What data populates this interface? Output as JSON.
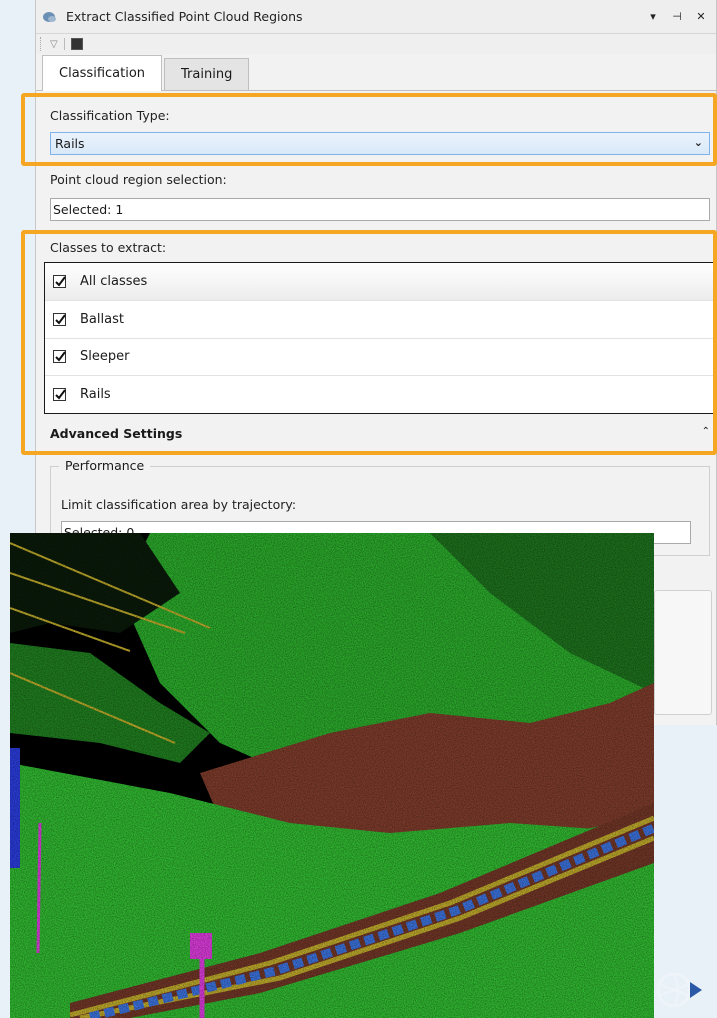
{
  "window": {
    "title": "Extract Classified Point Cloud Regions",
    "controls": [
      "▾",
      "⊣",
      "✕"
    ]
  },
  "tabs": [
    {
      "label": "Classification",
      "active": true
    },
    {
      "label": "Training",
      "active": false
    }
  ],
  "classification_type": {
    "label": "Classification Type:",
    "value": "Rails"
  },
  "region_selection": {
    "label": "Point cloud region selection:",
    "value": "Selected: 1"
  },
  "classes": {
    "label": "Classes to extract:",
    "header": {
      "label": "All classes",
      "checked": true
    },
    "items": [
      {
        "label": "Ballast",
        "checked": true
      },
      {
        "label": "Sleeper",
        "checked": true
      },
      {
        "label": "Rails",
        "checked": true
      }
    ]
  },
  "advanced": {
    "label": "Advanced Settings",
    "toggle": "⌃"
  },
  "performance": {
    "legend": "Performance",
    "trajectory_label": "Limit classification area by trajectory:",
    "trajectory_value": "Selected: 0"
  },
  "colors": {
    "highlight": "#f5a623",
    "vegetation": "#2fb32f",
    "ground": "#7a3a2a",
    "rail": "#b9a52a",
    "sleeper": "#3a6fd6",
    "pole": "#d63ad6"
  }
}
